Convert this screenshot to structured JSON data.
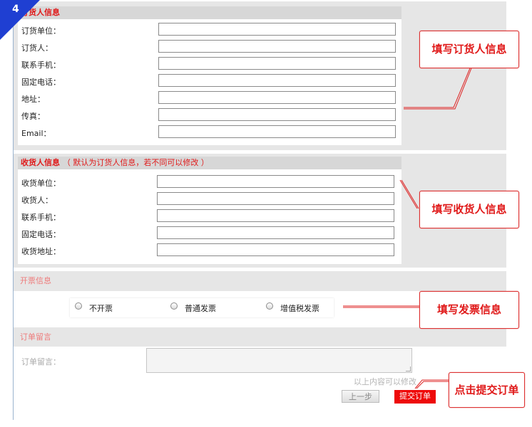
{
  "step_badge": "4",
  "orderer": {
    "title": "订货人信息",
    "fields": [
      {
        "label": "订货单位："
      },
      {
        "label": "订货人："
      },
      {
        "label": "联系手机："
      },
      {
        "label": "固定电话："
      },
      {
        "label": "地址："
      },
      {
        "label": "传真："
      },
      {
        "label": "Email："
      }
    ]
  },
  "receiver": {
    "title": "收货人信息",
    "note": "（ 默认为订货人信息，若不同可以修改 ）",
    "fields": [
      {
        "label": "收货单位："
      },
      {
        "label": "收货人："
      },
      {
        "label": "联系手机："
      },
      {
        "label": "固定电话："
      },
      {
        "label": "收货地址："
      }
    ]
  },
  "invoice": {
    "title": "开票信息",
    "options": [
      "不开票",
      "普通发票",
      "增值税发票"
    ]
  },
  "remark": {
    "title": "订单留言",
    "label": "订单留言：",
    "hint": "以上内容可以修改"
  },
  "buttons": {
    "prev": "上一步",
    "submit": "提交订单"
  },
  "callouts": {
    "orderer": "填写订货人信息",
    "receiver": "填写收货人信息",
    "invoice": "填写发票信息",
    "submit": "点击提交订单"
  },
  "colors": {
    "accent_red": "#e01a1a",
    "badge_blue": "#1f3fd2",
    "submit_red": "#ee0a0a"
  }
}
